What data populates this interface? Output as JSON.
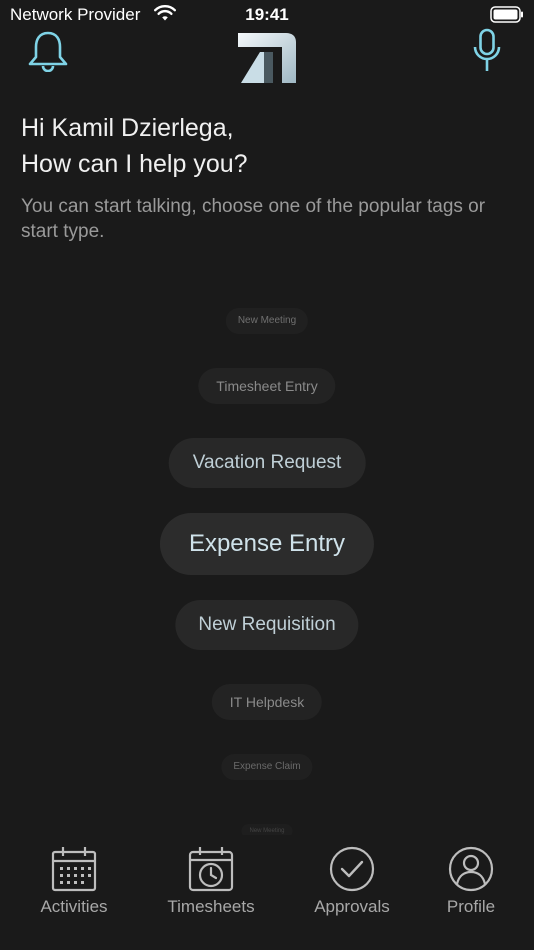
{
  "status_bar": {
    "carrier": "Network Provider",
    "time": "19:41"
  },
  "header": {
    "bell_icon": "bell-icon",
    "logo_icon": "app-logo",
    "mic_icon": "microphone-icon",
    "accent_color": "#7fd3e6"
  },
  "greeting": {
    "line1": "Hi Kamil Dzierlega,",
    "line2": "How can I help you?",
    "subtitle": "You can start talking, choose one of the popular tags or start type."
  },
  "tags": [
    "New Meeting",
    "Timesheet Entry",
    "Vacation Request",
    "Expense Entry",
    "New Requisition",
    "IT Helpdesk",
    "Expense Claim",
    "New Meeting"
  ],
  "tab_bar": {
    "items": [
      {
        "label": "Activities",
        "icon": "calendar-icon"
      },
      {
        "label": "Timesheets",
        "icon": "clock-calendar-icon"
      },
      {
        "label": "Approvals",
        "icon": "checkmark-circle-icon"
      },
      {
        "label": "Profile",
        "icon": "user-circle-icon"
      }
    ]
  }
}
